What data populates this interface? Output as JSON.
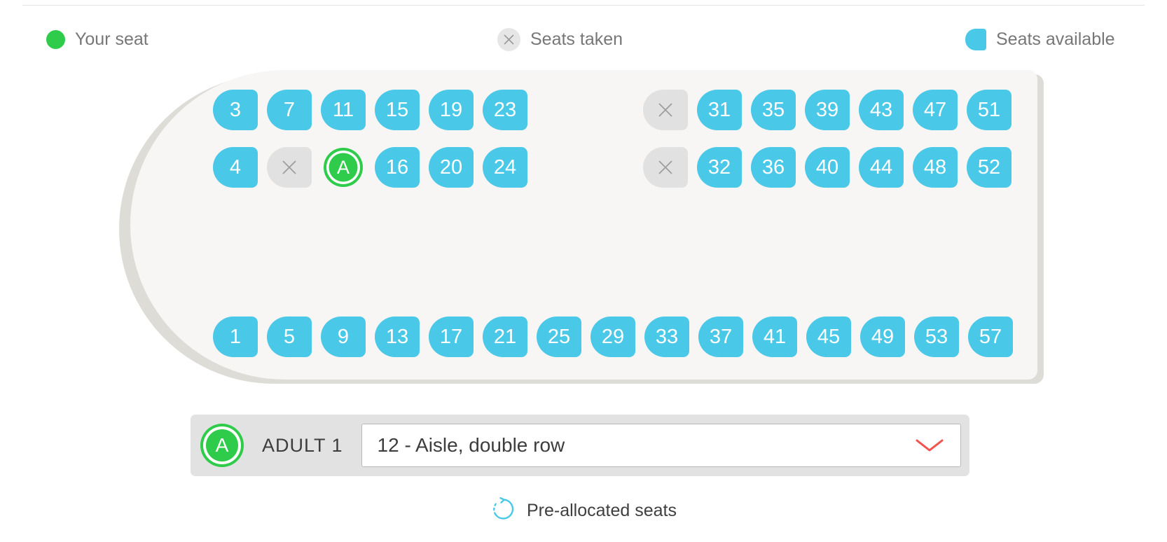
{
  "legend": {
    "items": [
      {
        "key": "your-seat",
        "label": "Your seat",
        "icon": "green-dot-icon",
        "color": "#2ecc4a"
      },
      {
        "key": "seats-taken",
        "label": "Seats taken",
        "icon": "x-circle-icon",
        "color": "#e6e6e6"
      },
      {
        "key": "seats-available",
        "label": "Seats available",
        "icon": "seat-shape-icon",
        "color": "#4ac8e8"
      }
    ]
  },
  "cabin": {
    "rows": [
      {
        "id": "row-a",
        "left_group": [
          {
            "label": "3",
            "state": "available"
          },
          {
            "label": "7",
            "state": "available"
          },
          {
            "label": "11",
            "state": "available"
          },
          {
            "label": "15",
            "state": "available"
          },
          {
            "label": "19",
            "state": "available"
          },
          {
            "label": "23",
            "state": "available"
          }
        ],
        "right_group": [
          {
            "label": "",
            "state": "taken"
          },
          {
            "label": "31",
            "state": "available"
          },
          {
            "label": "35",
            "state": "available"
          },
          {
            "label": "39",
            "state": "available"
          },
          {
            "label": "43",
            "state": "available"
          },
          {
            "label": "47",
            "state": "available"
          },
          {
            "label": "51",
            "state": "available"
          }
        ]
      },
      {
        "id": "row-b",
        "left_group": [
          {
            "label": "4",
            "state": "available"
          },
          {
            "label": "",
            "state": "taken"
          },
          {
            "label": "A",
            "state": "selected"
          },
          {
            "label": "16",
            "state": "available"
          },
          {
            "label": "20",
            "state": "available"
          },
          {
            "label": "24",
            "state": "available"
          }
        ],
        "right_group": [
          {
            "label": "",
            "state": "taken"
          },
          {
            "label": "32",
            "state": "available"
          },
          {
            "label": "36",
            "state": "available"
          },
          {
            "label": "40",
            "state": "available"
          },
          {
            "label": "44",
            "state": "available"
          },
          {
            "label": "48",
            "state": "available"
          },
          {
            "label": "52",
            "state": "available"
          }
        ]
      },
      {
        "id": "row-c",
        "left_group": [
          {
            "label": "1",
            "state": "available"
          },
          {
            "label": "5",
            "state": "available"
          },
          {
            "label": "9",
            "state": "available"
          },
          {
            "label": "13",
            "state": "available"
          },
          {
            "label": "17",
            "state": "available"
          },
          {
            "label": "21",
            "state": "available"
          },
          {
            "label": "25",
            "state": "available"
          },
          {
            "label": "29",
            "state": "available"
          },
          {
            "label": "33",
            "state": "available"
          },
          {
            "label": "37",
            "state": "available"
          },
          {
            "label": "41",
            "state": "available"
          },
          {
            "label": "45",
            "state": "available"
          },
          {
            "label": "49",
            "state": "available"
          },
          {
            "label": "53",
            "state": "available"
          },
          {
            "label": "57",
            "state": "available"
          }
        ],
        "right_group": []
      }
    ]
  },
  "selector": {
    "badge_letter": "A",
    "passenger_label": "ADULT 1",
    "selected_seat": "12 - Aisle, double row",
    "chevron_color": "#f4524d"
  },
  "footer": {
    "label": "Pre-allocated seats",
    "icon": "refresh-spinner-icon",
    "icon_color": "#4ac8e8"
  },
  "colors": {
    "seat_available": "#4ac8e8",
    "seat_taken": "#e2e1e1",
    "seat_selected": "#2ecc4a",
    "cabin_body": "#f7f6f4",
    "cabin_outline": "#dedcd7",
    "text_muted": "#777777",
    "text_dark": "#3d3d3d"
  }
}
